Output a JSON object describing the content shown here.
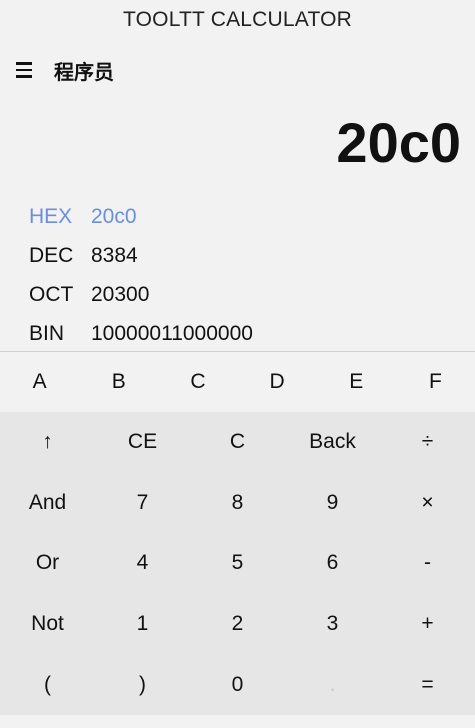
{
  "window": {
    "title": "TOOLTT CALCULATOR"
  },
  "header": {
    "menu_icon": "hamburger-icon",
    "mode": "程序员"
  },
  "display": {
    "value": "20c0"
  },
  "bases": [
    {
      "label": "HEX",
      "value": "20c0",
      "active": true
    },
    {
      "label": "DEC",
      "value": "8384",
      "active": false
    },
    {
      "label": "OCT",
      "value": "20300",
      "active": false
    },
    {
      "label": "BIN",
      "value": "10000011000000",
      "active": false
    }
  ],
  "hex_keys": [
    "A",
    "B",
    "C",
    "D",
    "E",
    "F"
  ],
  "keys": [
    [
      "↑",
      "CE",
      "C",
      "Back",
      "÷"
    ],
    [
      "And",
      "7",
      "8",
      "9",
      "×"
    ],
    [
      "Or",
      "4",
      "5",
      "6",
      "-"
    ],
    [
      "Not",
      "1",
      "2",
      "3",
      "+"
    ],
    [
      "(",
      ")",
      "0",
      ".",
      "="
    ]
  ],
  "colors": {
    "accent": "#6b8fdc",
    "background": "#f2f2f2",
    "keypad": "#e6e6e6"
  }
}
